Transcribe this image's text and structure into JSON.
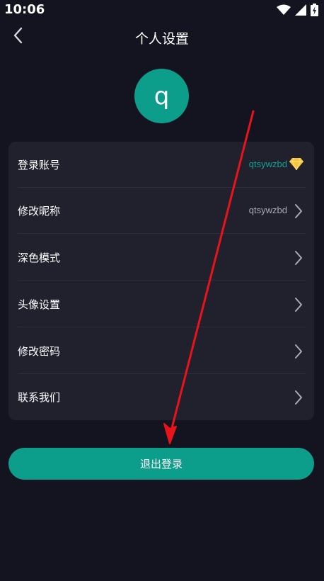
{
  "status_bar": {
    "time": "10:06",
    "icons": [
      "wifi-icon",
      "signal-icon",
      "battery-charging-icon"
    ]
  },
  "header": {
    "title": "个人设置",
    "back_icon": "chevron-left-icon"
  },
  "profile": {
    "avatar_letter": "q",
    "avatar_color": "#0d9e8b"
  },
  "settings": {
    "items": [
      {
        "label": "登录账号",
        "value": "qtsywzbd",
        "trailing_icon": "diamond-icon"
      },
      {
        "label": "修改昵称",
        "value": "qtsywzbd",
        "trailing_icon": "chevron-right-icon"
      },
      {
        "label": "深色模式",
        "value": "",
        "trailing_icon": "chevron-right-icon"
      },
      {
        "label": "头像设置",
        "value": "",
        "trailing_icon": "chevron-right-icon"
      },
      {
        "label": "修改密码",
        "value": "",
        "trailing_icon": "chevron-right-icon"
      },
      {
        "label": "联系我们",
        "value": "",
        "trailing_icon": "chevron-right-icon"
      }
    ]
  },
  "logout": {
    "label": "退出登录"
  },
  "colors": {
    "background": "#13141f",
    "card": "#20212d",
    "accent": "#0d9e8b",
    "annotation": "#e8141a",
    "diamond": "#f5c53a"
  }
}
